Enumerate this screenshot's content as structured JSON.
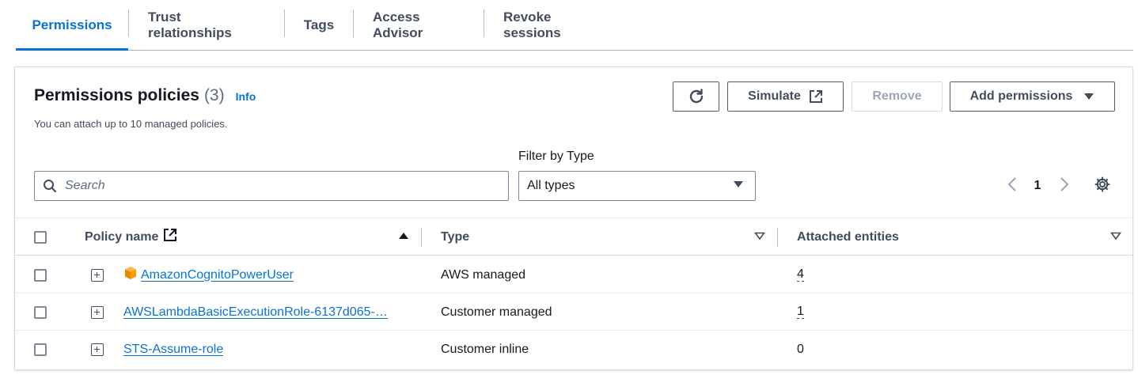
{
  "tabs": [
    {
      "label": "Permissions",
      "active": true
    },
    {
      "label": "Trust relationships",
      "active": false
    },
    {
      "label": "Tags",
      "active": false
    },
    {
      "label": "Access Advisor",
      "active": false
    },
    {
      "label": "Revoke sessions",
      "active": false
    }
  ],
  "panel": {
    "title": "Permissions policies",
    "count": "(3)",
    "info_link": "Info",
    "description": "You can attach up to 10 managed policies."
  },
  "actions": {
    "refresh_icon": "refresh-icon",
    "simulate_label": "Simulate",
    "remove_label": "Remove",
    "add_permissions_label": "Add permissions"
  },
  "filter": {
    "label": "Filter by Type",
    "selected": "All types",
    "search_placeholder": "Search"
  },
  "pagination": {
    "current_page": "1"
  },
  "table": {
    "columns": {
      "policy_name": "Policy name",
      "type": "Type",
      "attached_entities": "Attached entities"
    },
    "rows": [
      {
        "name": "AmazonCognitoPowerUser",
        "type": "AWS managed",
        "entities": "4",
        "aws_icon": true
      },
      {
        "name": "AWSLambdaBasicExecutionRole-6137d065-…",
        "type": "Customer managed",
        "entities": "1",
        "aws_icon": false
      },
      {
        "name": "STS-Assume-role",
        "type": "Customer inline",
        "entities": "0",
        "aws_icon": false
      }
    ]
  },
  "colors": {
    "accent": "#0972d3",
    "aws_orange": "#ff9900"
  }
}
